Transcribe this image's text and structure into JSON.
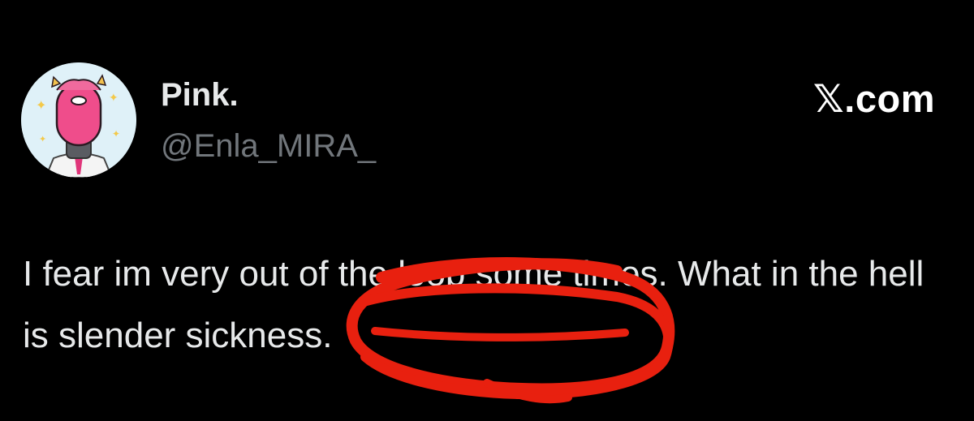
{
  "tweet": {
    "display_name": "Pink.",
    "handle": "@Enla_MIRA_",
    "text": "I fear im very out of the loop some times. What in the hell is slender sickness."
  },
  "brand": {
    "label": "𝕏.com"
  },
  "icons": {
    "avatar": "pink-character-avatar",
    "annotation": "red-scribble-circle"
  },
  "colors": {
    "background": "#000000",
    "name_text": "#e7e9ea",
    "handle_text": "#71767b",
    "annotation_red": "#e8200f"
  }
}
